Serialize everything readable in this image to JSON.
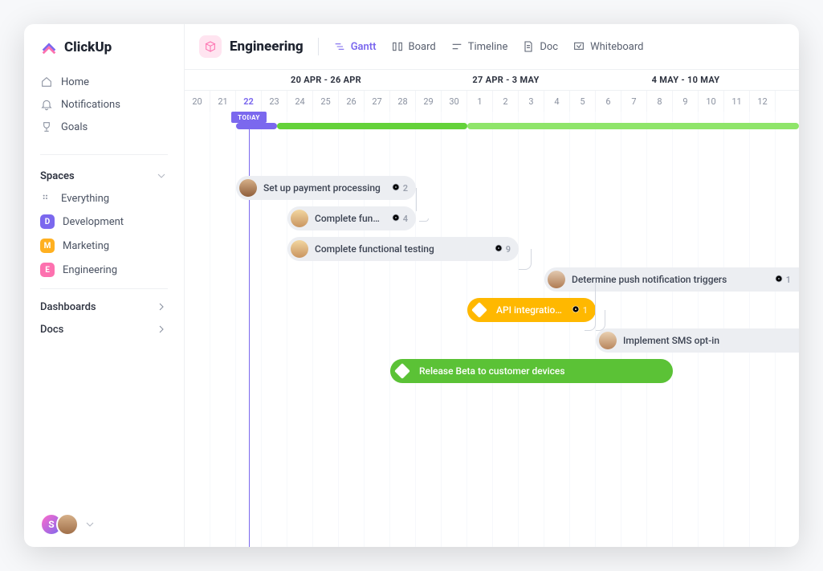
{
  "brand": "ClickUp",
  "nav": {
    "home": "Home",
    "notifications": "Notifications",
    "goals": "Goals"
  },
  "spaces": {
    "label": "Spaces",
    "everything": "Everything",
    "items": [
      {
        "badge": "D",
        "label": "Development"
      },
      {
        "badge": "M",
        "label": "Marketing"
      },
      {
        "badge": "E",
        "label": "Engineering"
      }
    ]
  },
  "sections": {
    "dashboards": "Dashboards",
    "docs": "Docs"
  },
  "footer_avatar_initial": "S",
  "current_space": "Engineering",
  "views": {
    "gantt": "Gantt",
    "board": "Board",
    "timeline": "Timeline",
    "doc": "Doc",
    "whiteboard": "Whiteboard"
  },
  "gantt": {
    "week_labels": [
      "20 APR - 26 APR",
      "27 APR - 3 MAY",
      "4 MAY - 10 MAY"
    ],
    "day_labels": [
      "20",
      "21",
      "22",
      "23",
      "24",
      "25",
      "26",
      "27",
      "28",
      "29",
      "30",
      "1",
      "2",
      "3",
      "4",
      "5",
      "6",
      "7",
      "8",
      "9",
      "10",
      "11",
      "12"
    ],
    "today_index": 2,
    "today_label": "TODAY",
    "tasks": [
      {
        "label": "Set up payment processing",
        "count": "2",
        "start": 2,
        "span": 7,
        "avatar": "av1"
      },
      {
        "label": "Complete functio...",
        "count": "4",
        "start": 4,
        "span": 5,
        "avatar": "av2"
      },
      {
        "label": "Complete functional testing",
        "count": "9",
        "start": 4,
        "span": 9,
        "avatar": "av2"
      },
      {
        "label": "Determine push notification triggers",
        "count": "1",
        "start": 14,
        "span": 10,
        "avatar": "av3",
        "right_extend": true
      },
      {
        "label": "API integration...",
        "count": "1",
        "start": 11,
        "span": 5,
        "style": "yellow"
      },
      {
        "label": "Implement SMS opt-in",
        "count": "",
        "start": 16,
        "span": 8,
        "avatar": "av5",
        "right_extend": true
      },
      {
        "label": "Release Beta to customer devices",
        "count": "",
        "start": 8,
        "span": 11,
        "style": "green"
      }
    ]
  }
}
